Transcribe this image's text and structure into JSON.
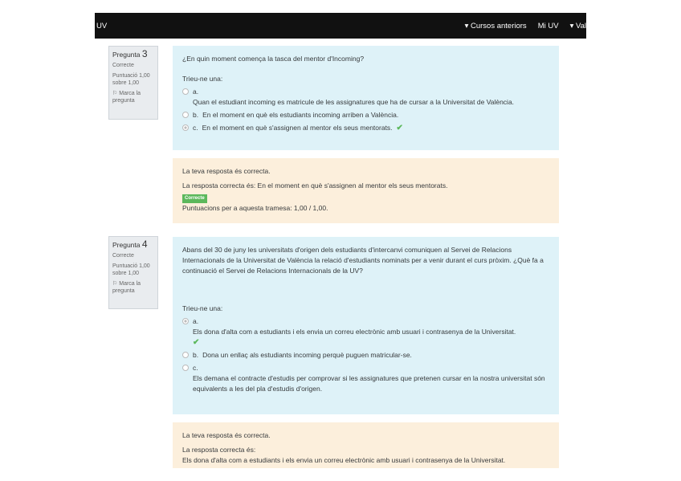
{
  "nav": {
    "brand": "UV",
    "items": [
      "▾ Cursos anteriors",
      "Mi UV",
      "▾ Val"
    ]
  },
  "q3": {
    "info": {
      "label": "Pregunta",
      "number": "3",
      "state": "Correcte",
      "score1": "Puntuació 1,00",
      "score2": "sobre 1,00",
      "flag": "Marca la pregunta"
    },
    "text": "¿En quin moment comença la tasca del mentor d'Incoming?",
    "prompt": "Trieu-ne una:",
    "options": [
      {
        "letter": "a.",
        "text": "Quan el estudiant incoming es matricule de les assignatures que ha de cursar a la Universitat de València.",
        "selected": false
      },
      {
        "letter": "b.",
        "text": "En el moment en què els estudiants incoming arriben a València.",
        "selected": false
      },
      {
        "letter": "c.",
        "text": "En el moment en què s'assignen al mentor els seus mentorats.",
        "selected": true
      }
    ],
    "feedback": {
      "result": "La teva resposta és correcta.",
      "correct": "La resposta correcta és: En el moment en què s'assignen al mentor els seus mentorats.",
      "badge": "Correcte",
      "score": "Puntuacions per a aquesta tramesa: 1,00 / 1,00."
    }
  },
  "q4": {
    "info": {
      "label": "Pregunta",
      "number": "4",
      "state": "Correcte",
      "score1": "Puntuació 1,00",
      "score2": "sobre 1,00",
      "flag": "Marca la pregunta"
    },
    "text": "Abans del 30 de juny les universitats d'origen dels estudiants d'intercanvi comuniquen al Servei de Relacions Internacionals de la Universitat de València la relació d'estudiants nominats per a venir durant el curs pròxim. ¿Què fa a continuació el Servei de Relacions Internacionals de la UV?",
    "prompt": "Trieu-ne una:",
    "options": [
      {
        "letter": "a.",
        "text": "Els dona d'alta com a estudiants i els envia un correu electrònic amb usuari i contrasenya de la Universitat.",
        "selected": true
      },
      {
        "letter": "b.",
        "text": "Dona un enllaç als estudiants incoming perquè puguen matricular-se.",
        "selected": false
      },
      {
        "letter": "c.",
        "text": "Els demana el contracte d'estudis per comprovar si les assignatures que pretenen cursar en la nostra universitat són equivalents a les del pla d'estudis d'origen.",
        "selected": false
      }
    ],
    "feedback": {
      "result": "La teva resposta és correcta.",
      "correct_label": "La resposta correcta és:",
      "correct": "Els dona d'alta com a estudiants i els envia un correu electrònic amb usuari i contrasenya de la Universitat."
    }
  },
  "colors": {
    "question_bg": "#def2f8",
    "feedback_bg": "#fcefdc",
    "correct": "#5cb85c"
  }
}
